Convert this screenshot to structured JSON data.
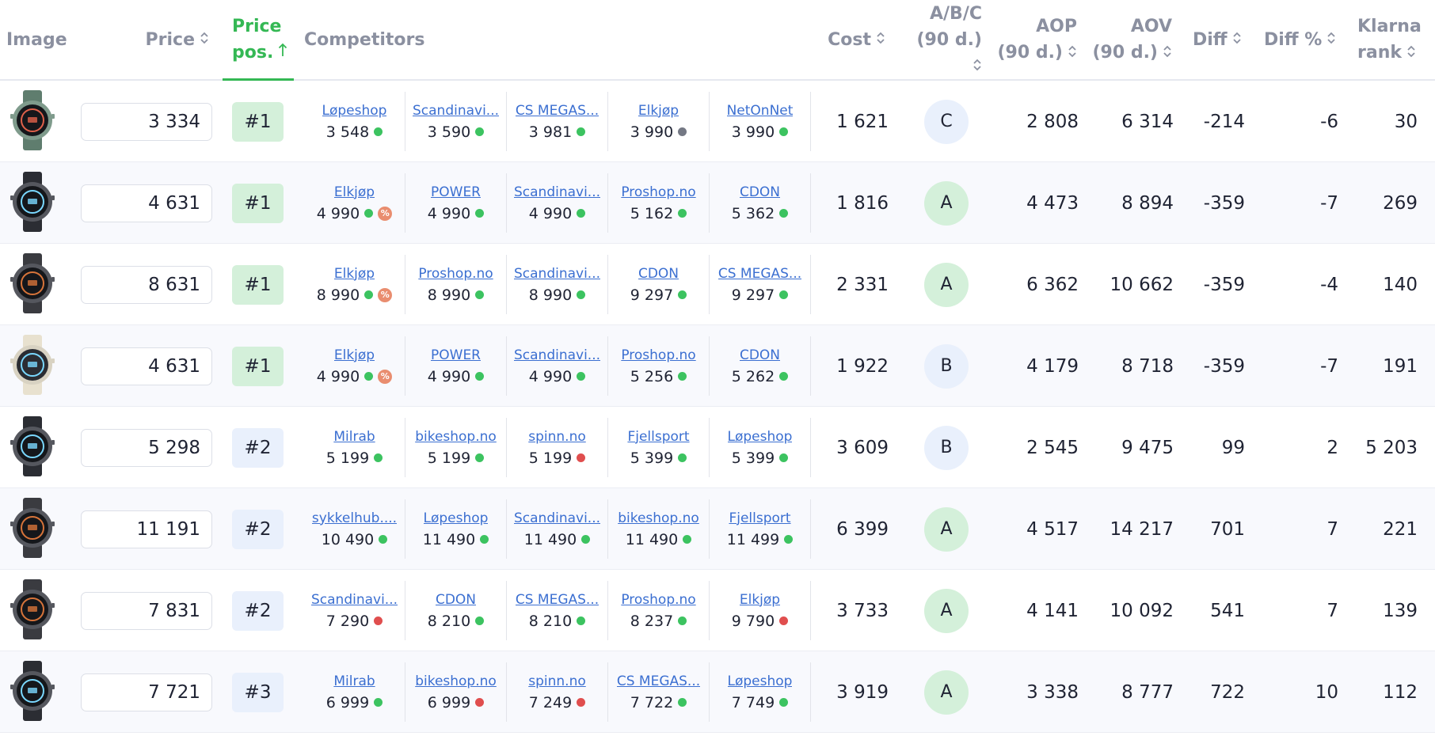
{
  "colors": {
    "accent_green": "#34b854",
    "dot_green": "#3cc360",
    "dot_red": "#e04e4e",
    "dot_gray": "#747884",
    "link_blue": "#3b6fd1"
  },
  "header": {
    "image": "Image",
    "price": "Price",
    "price_pos_line1": "Price",
    "price_pos_line2": "pos.",
    "competitors": "Competitors",
    "cost": "Cost",
    "abc_line1": "A/B/C",
    "abc_line2": "(90 d.)",
    "aop_line1": "AOP",
    "aop_line2": "(90 d.)",
    "aov_line1": "AOV",
    "aov_line2": "(90 d.)",
    "diff": "Diff",
    "diff_pct": "Diff %",
    "klarna_line1": "Klarna",
    "klarna_line2": "rank"
  },
  "rows": [
    {
      "watch": "green-watch-icon",
      "price": "3 334",
      "pos": "#1",
      "pos_style": "green",
      "competitors": [
        {
          "name": "Løpeshop",
          "price": "3 548",
          "dot": "green",
          "discount": false
        },
        {
          "name": "Scandinavi...",
          "price": "3 590",
          "dot": "green",
          "discount": false
        },
        {
          "name": "CS MEGAS...",
          "price": "3 981",
          "dot": "green",
          "discount": false
        },
        {
          "name": "Elkjøp",
          "price": "3 990",
          "dot": "gray",
          "discount": false
        },
        {
          "name": "NetOnNet",
          "price": "3 990",
          "dot": "green",
          "discount": false
        }
      ],
      "cost": "1 621",
      "abc": "C",
      "aop": "2 808",
      "aov": "6 314",
      "diff": "-214",
      "diff_pct": "-6",
      "klarna": "30"
    },
    {
      "watch": "black-watch-icon",
      "price": "4 631",
      "pos": "#1",
      "pos_style": "green",
      "competitors": [
        {
          "name": "Elkjøp",
          "price": "4 990",
          "dot": "green",
          "discount": true
        },
        {
          "name": "POWER",
          "price": "4 990",
          "dot": "green",
          "discount": false
        },
        {
          "name": "Scandinavi...",
          "price": "4 990",
          "dot": "green",
          "discount": false
        },
        {
          "name": "Proshop.no",
          "price": "5 162",
          "dot": "green",
          "discount": false
        },
        {
          "name": "CDON",
          "price": "5 362",
          "dot": "green",
          "discount": false
        }
      ],
      "cost": "1 816",
      "abc": "A",
      "aop": "4 473",
      "aov": "8 894",
      "diff": "-359",
      "diff_pct": "-7",
      "klarna": "269"
    },
    {
      "watch": "dark-watch-icon",
      "price": "8 631",
      "pos": "#1",
      "pos_style": "green",
      "competitors": [
        {
          "name": "Elkjøp",
          "price": "8 990",
          "dot": "green",
          "discount": true
        },
        {
          "name": "Proshop.no",
          "price": "8 990",
          "dot": "green",
          "discount": false
        },
        {
          "name": "Scandinavi...",
          "price": "8 990",
          "dot": "green",
          "discount": false
        },
        {
          "name": "CDON",
          "price": "9 297",
          "dot": "green",
          "discount": false
        },
        {
          "name": "CS MEGAS...",
          "price": "9 297",
          "dot": "green",
          "discount": false
        }
      ],
      "cost": "2 331",
      "abc": "A",
      "aop": "6 362",
      "aov": "10 662",
      "diff": "-359",
      "diff_pct": "-4",
      "klarna": "140"
    },
    {
      "watch": "white-watch-icon",
      "price": "4 631",
      "pos": "#1",
      "pos_style": "green",
      "competitors": [
        {
          "name": "Elkjøp",
          "price": "4 990",
          "dot": "green",
          "discount": true
        },
        {
          "name": "POWER",
          "price": "4 990",
          "dot": "green",
          "discount": false
        },
        {
          "name": "Scandinavi...",
          "price": "4 990",
          "dot": "green",
          "discount": false
        },
        {
          "name": "Proshop.no",
          "price": "5 256",
          "dot": "green",
          "discount": false
        },
        {
          "name": "CDON",
          "price": "5 262",
          "dot": "green",
          "discount": false
        }
      ],
      "cost": "1 922",
      "abc": "B",
      "aop": "4 179",
      "aov": "8 718",
      "diff": "-359",
      "diff_pct": "-7",
      "klarna": "191"
    },
    {
      "watch": "black-watch-icon",
      "price": "5 298",
      "pos": "#2",
      "pos_style": "blue",
      "competitors": [
        {
          "name": "Milrab",
          "price": "5 199",
          "dot": "green",
          "discount": false
        },
        {
          "name": "bikeshop.no",
          "price": "5 199",
          "dot": "green",
          "discount": false
        },
        {
          "name": "spinn.no",
          "price": "5 199",
          "dot": "red",
          "discount": false
        },
        {
          "name": "Fjellsport",
          "price": "5 399",
          "dot": "green",
          "discount": false
        },
        {
          "name": "Løpeshop",
          "price": "5 399",
          "dot": "green",
          "discount": false
        }
      ],
      "cost": "3 609",
      "abc": "B",
      "aop": "2 545",
      "aov": "9 475",
      "diff": "99",
      "diff_pct": "2",
      "klarna": "5 203"
    },
    {
      "watch": "dark-watch-icon",
      "price": "11 191",
      "pos": "#2",
      "pos_style": "blue",
      "competitors": [
        {
          "name": "sykkelhub....",
          "price": "10 490",
          "dot": "green",
          "discount": false
        },
        {
          "name": "Løpeshop",
          "price": "11 490",
          "dot": "green",
          "discount": false
        },
        {
          "name": "Scandinavi...",
          "price": "11 490",
          "dot": "green",
          "discount": false
        },
        {
          "name": "bikeshop.no",
          "price": "11 490",
          "dot": "green",
          "discount": false
        },
        {
          "name": "Fjellsport",
          "price": "11 499",
          "dot": "green",
          "discount": false
        }
      ],
      "cost": "6 399",
      "abc": "A",
      "aop": "4 517",
      "aov": "14 217",
      "diff": "701",
      "diff_pct": "7",
      "klarna": "221"
    },
    {
      "watch": "dark-watch-icon",
      "price": "7 831",
      "pos": "#2",
      "pos_style": "blue",
      "competitors": [
        {
          "name": "Scandinavi...",
          "price": "7 290",
          "dot": "red",
          "discount": false
        },
        {
          "name": "CDON",
          "price": "8 210",
          "dot": "green",
          "discount": false
        },
        {
          "name": "CS MEGAS...",
          "price": "8 210",
          "dot": "green",
          "discount": false
        },
        {
          "name": "Proshop.no",
          "price": "8 237",
          "dot": "green",
          "discount": false
        },
        {
          "name": "Elkjøp",
          "price": "9 790",
          "dot": "red",
          "discount": false
        }
      ],
      "cost": "3 733",
      "abc": "A",
      "aop": "4 141",
      "aov": "10 092",
      "diff": "541",
      "diff_pct": "7",
      "klarna": "139"
    },
    {
      "watch": "black-watch-icon",
      "price": "7 721",
      "pos": "#3",
      "pos_style": "blue",
      "competitors": [
        {
          "name": "Milrab",
          "price": "6 999",
          "dot": "green",
          "discount": false
        },
        {
          "name": "bikeshop.no",
          "price": "6 999",
          "dot": "red",
          "discount": false
        },
        {
          "name": "spinn.no",
          "price": "7 249",
          "dot": "red",
          "discount": false
        },
        {
          "name": "CS MEGAS...",
          "price": "7 722",
          "dot": "green",
          "discount": false
        },
        {
          "name": "Løpeshop",
          "price": "7 749",
          "dot": "green",
          "discount": false
        }
      ],
      "cost": "3 919",
      "abc": "A",
      "aop": "3 338",
      "aov": "8 777",
      "diff": "722",
      "diff_pct": "10",
      "klarna": "112"
    }
  ]
}
